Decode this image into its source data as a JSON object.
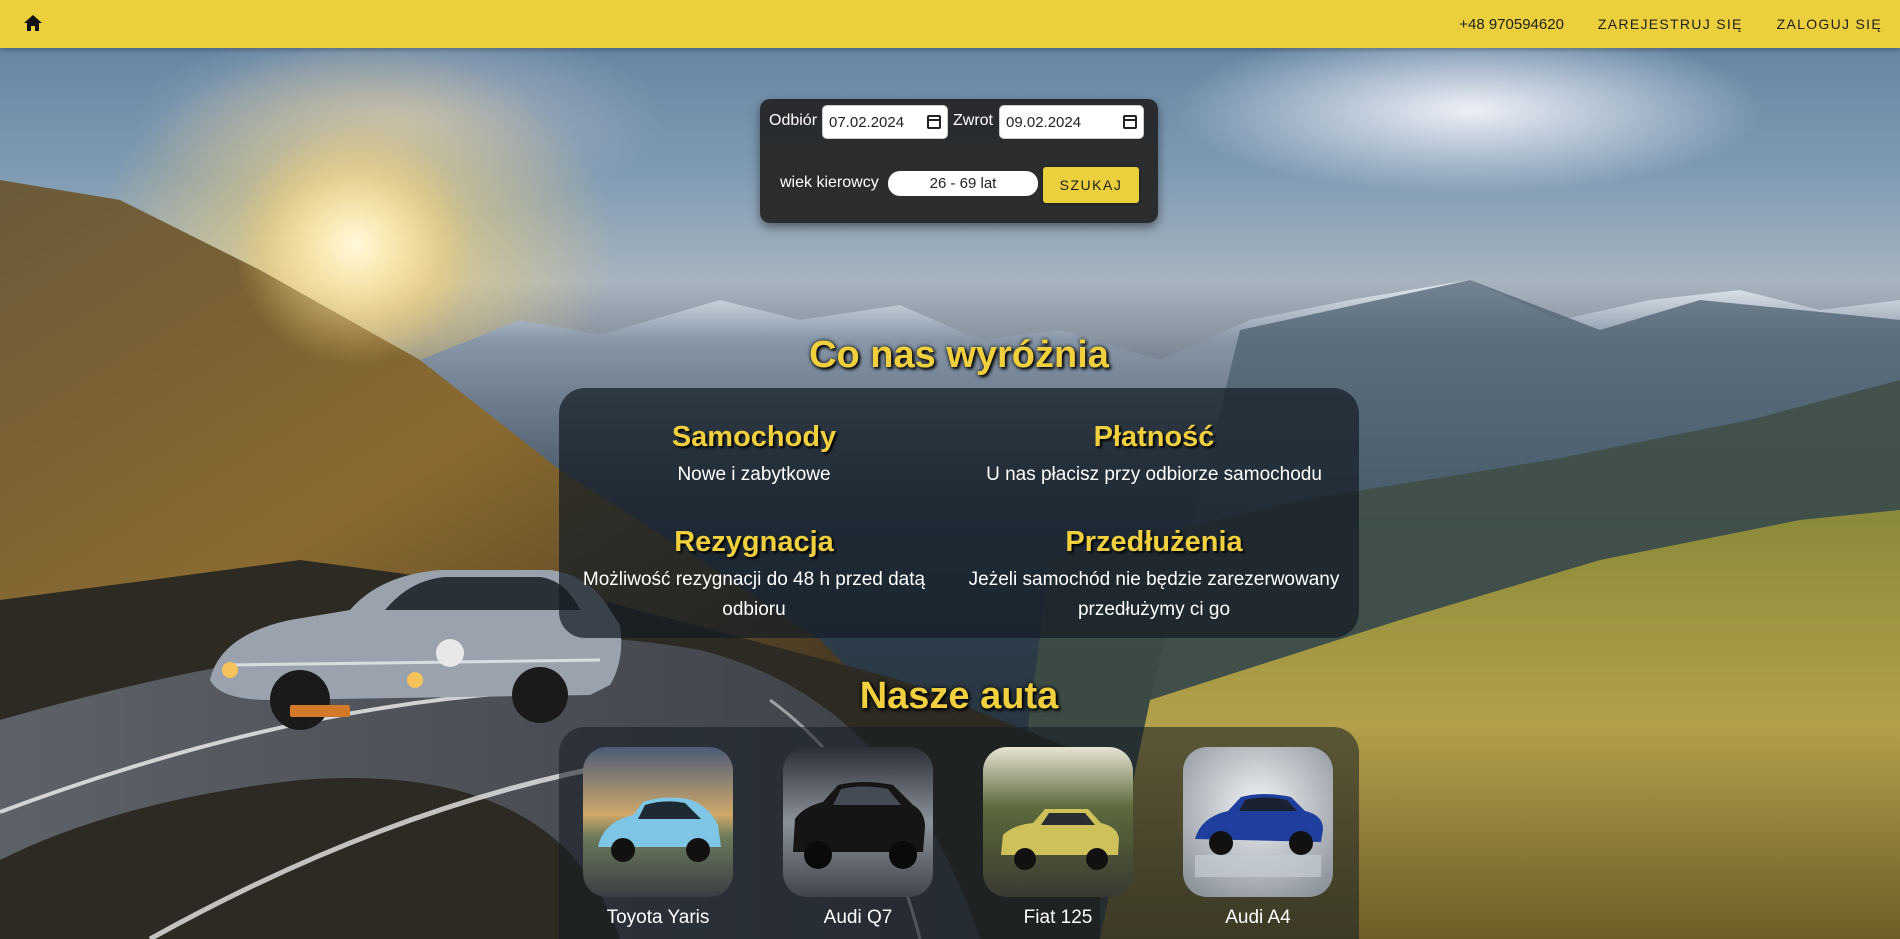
{
  "topbar": {
    "home_icon": "home-icon",
    "phone": "+48 970594620",
    "register": "ZAREJESTRUJ SIĘ",
    "login": "ZALOGUJ SIĘ",
    "bar_color": "#ebcf3d"
  },
  "search": {
    "pickup_label": "Odbiór",
    "pickup_value": "07.02.2024",
    "return_label": "Zwrot",
    "return_value": "09.02.2024",
    "age_label": "wiek kierowcy",
    "age_value": "26 - 69 lat",
    "search_button": "SZUKAJ"
  },
  "features": {
    "title": "Co nas wyróżnia",
    "items": [
      {
        "title": "Samochody",
        "text": "Nowe i zabytkowe"
      },
      {
        "title": "Płatność",
        "text": "U nas płacisz przy odbiorze samochodu"
      },
      {
        "title": "Rezygnacja",
        "text": "Możliwość rezygnacji do 48 h przed datą odbioru"
      },
      {
        "title": "Przedłużenia",
        "text": "Jeżeli samochód nie będzie zarezerwowany przedłużymy ci go"
      }
    ]
  },
  "cars": {
    "title": "Nasze auta",
    "items": [
      {
        "name": "Toyota Yaris",
        "color": "#7fc6e6"
      },
      {
        "name": "Audi Q7",
        "color": "#151515"
      },
      {
        "name": "Fiat 125",
        "color": "#cfc15a"
      },
      {
        "name": "Audi A4",
        "color": "#1f3f9e"
      }
    ]
  },
  "accent_color": "#f1d03f"
}
